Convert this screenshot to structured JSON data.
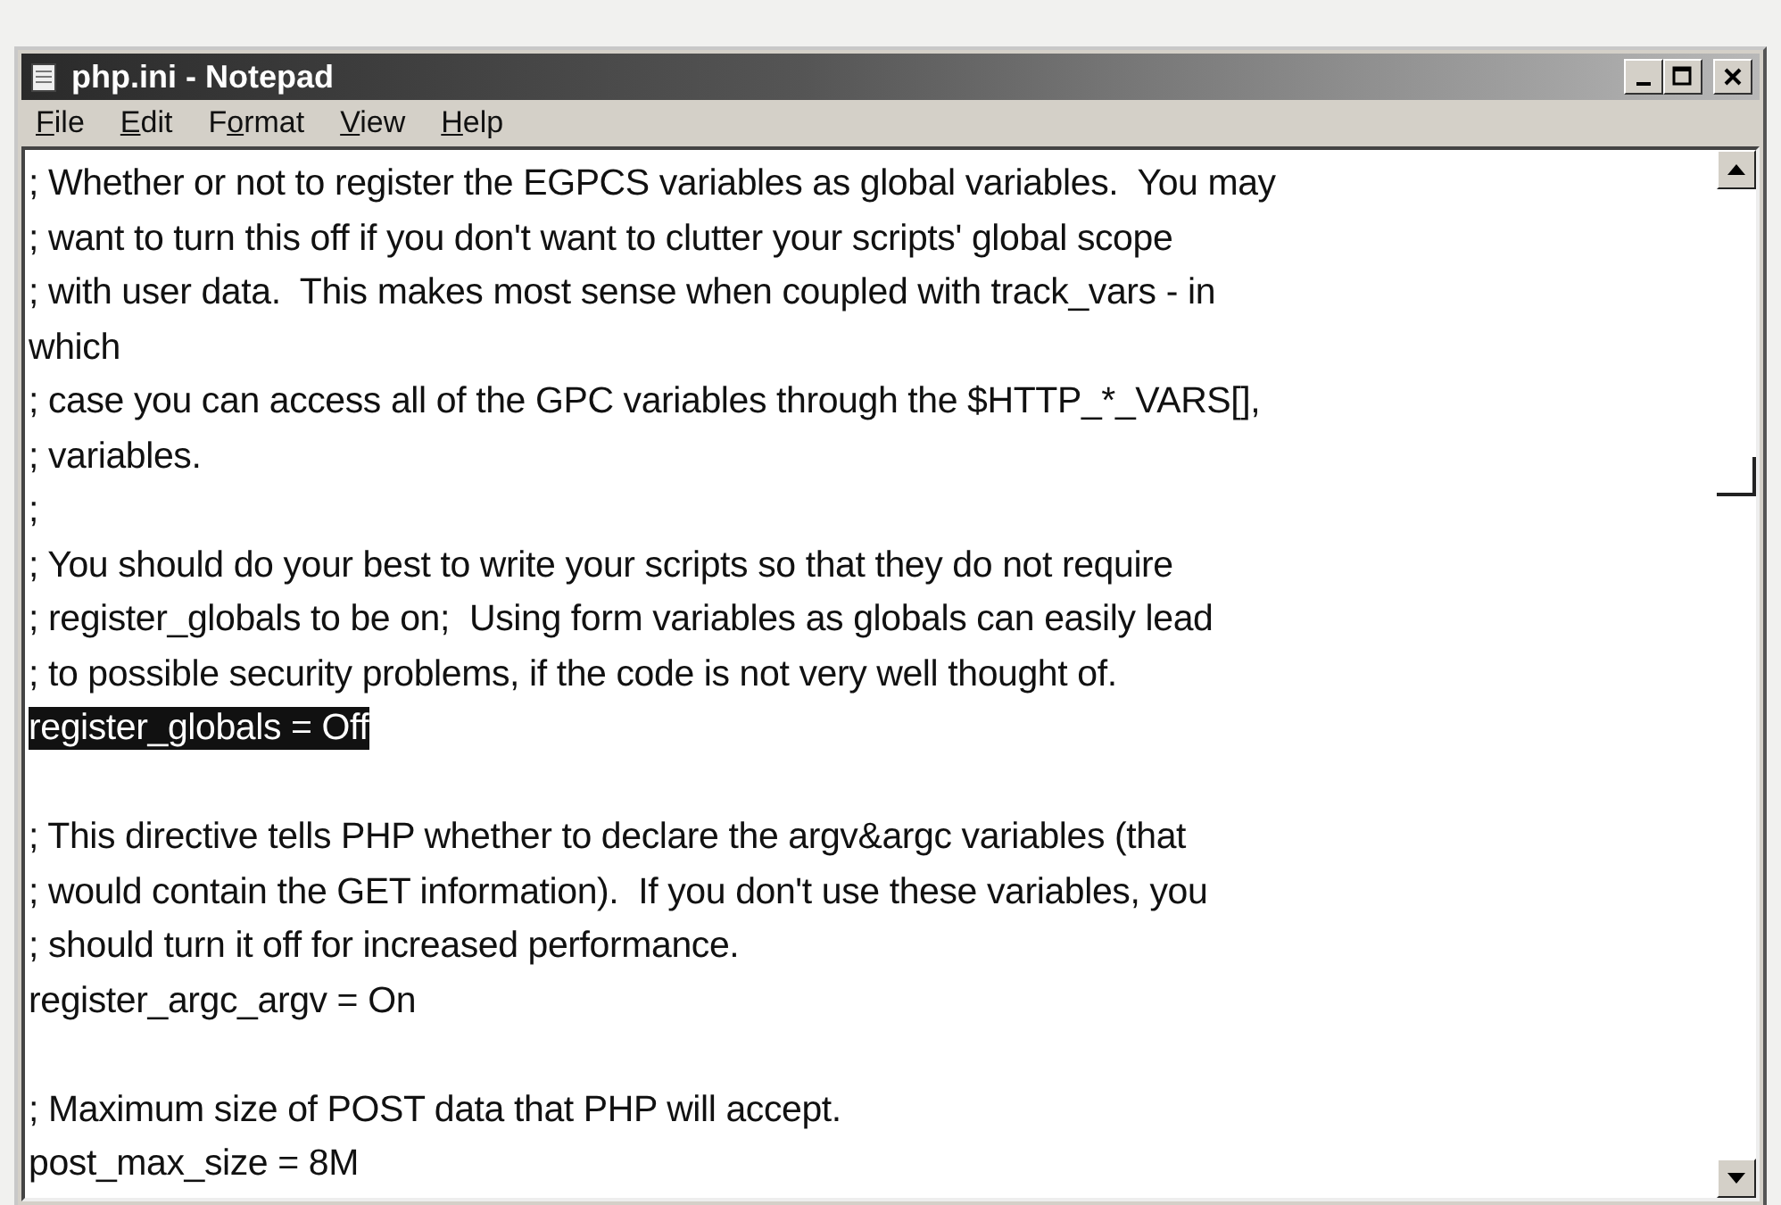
{
  "window": {
    "title": "php.ini - Notepad"
  },
  "menu": [
    {
      "access_key": "F",
      "rest": "ile"
    },
    {
      "access_key": "E",
      "rest": "dit"
    },
    {
      "prefix": "F",
      "access_key": "o",
      "rest": "rmat"
    },
    {
      "access_key": "V",
      "rest": "iew"
    },
    {
      "access_key": "H",
      "rest": "elp"
    }
  ],
  "editor": {
    "lines": [
      {
        "kind": "text",
        "text": "; Whether or not to register the EGPCS variables as global variables.  You may",
        "selected": false
      },
      {
        "kind": "text",
        "text": "; want to turn this off if you don't want to clutter your scripts' global scope",
        "selected": false
      },
      {
        "kind": "text",
        "text": "; with user data.  This makes most sense when coupled with track_vars - in",
        "selected": false
      },
      {
        "kind": "text",
        "text": "which",
        "selected": false
      },
      {
        "kind": "text",
        "text": "; case you can access all of the GPC variables through the $HTTP_*_VARS[],",
        "selected": false
      },
      {
        "kind": "text",
        "text": "; variables.",
        "selected": false
      },
      {
        "kind": "text",
        "text": ";",
        "selected": false
      },
      {
        "kind": "text",
        "text": "; You should do your best to write your scripts so that they do not require",
        "selected": false
      },
      {
        "kind": "text",
        "text": "; register_globals to be on;  Using form variables as globals can easily lead",
        "selected": false
      },
      {
        "kind": "text",
        "text": "; to possible security problems, if the code is not very well thought of.",
        "selected": false
      },
      {
        "kind": "text",
        "text": "register_globals = Off",
        "selected": true
      },
      {
        "kind": "blank"
      },
      {
        "kind": "text",
        "text": "; This directive tells PHP whether to declare the argv&argc variables (that",
        "selected": false
      },
      {
        "kind": "text",
        "text": "; would contain the GET information).  If you don't use these variables, you",
        "selected": false
      },
      {
        "kind": "text",
        "text": "; should turn it off for increased performance.",
        "selected": false
      },
      {
        "kind": "text",
        "text": "register_argc_argv = On",
        "selected": false
      },
      {
        "kind": "blank"
      },
      {
        "kind": "text",
        "text": "; Maximum size of POST data that PHP will accept.",
        "selected": false
      },
      {
        "kind": "text",
        "text": "post_max_size = 8M",
        "selected": false
      }
    ]
  }
}
